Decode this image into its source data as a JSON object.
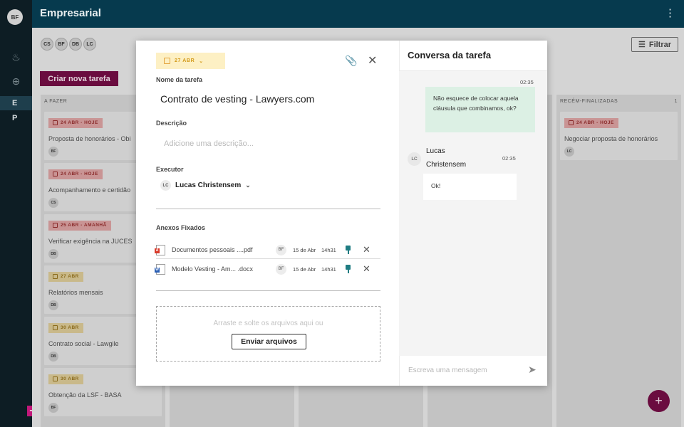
{
  "rail": {
    "avatar": "BF",
    "items": [
      "E",
      "P"
    ]
  },
  "topbar": {
    "title": "Empresarial"
  },
  "users": [
    "CS",
    "BF",
    "DB",
    "LC"
  ],
  "filter_label": "Filtrar",
  "create_task_label": "Criar nova tarefa",
  "columns": [
    {
      "title": "A FAZER",
      "count": "",
      "cards": [
        {
          "due": "24 ABR - HOJE",
          "color": "red",
          "title": "Proposta de honorários - Obi",
          "user": "BF"
        },
        {
          "due": "24 ABR - HOJE",
          "color": "red",
          "title": "Acompanhamento e certidão",
          "user": "CS"
        },
        {
          "due": "25 ABR - AMANHÃ",
          "color": "red",
          "title": "Verificar exigência na JUCES",
          "user": "DB"
        },
        {
          "due": "27 ABR",
          "color": "amber",
          "title": "Relatórios mensais",
          "user": "DB"
        },
        {
          "due": "30 ABR",
          "color": "amber",
          "title": "Contrato social - Lawgile",
          "user": "DB"
        },
        {
          "due": "30 ABR",
          "color": "amber",
          "title": "Obtenção da LSF - BASA",
          "user": "BF"
        }
      ]
    },
    {
      "title": "RECÉM-FINALIZADAS",
      "count": "1",
      "cards": [
        {
          "due": "24 ABR - HOJE",
          "color": "red",
          "title": "Negociar proposta de honorários",
          "user": "LC"
        }
      ]
    }
  ],
  "modal": {
    "due_chip": "27 ABR",
    "task_name_label": "Nome da tarefa",
    "task_name": "Contrato de vesting - Lawyers.com",
    "description_label": "Descrição",
    "description_placeholder": "Adicione uma descrição...",
    "executor_label": "Executor",
    "executor": {
      "initials": "LC",
      "name": "Lucas Christensem"
    },
    "attachments_label": "Anexos Fixados",
    "attachments": [
      {
        "type": "pdf",
        "name": "Documentos pessoais ....pdf",
        "user": "BF",
        "date": "15 de Abr",
        "time": "14h31"
      },
      {
        "type": "docx",
        "name": "Modelo Vesting - Am... .docx",
        "user": "BF",
        "date": "15 de Abr",
        "time": "14h31"
      }
    ],
    "drop_hint": "Arraste e solte os arquivos aqui ou",
    "upload_label": "Enviar arquivos"
  },
  "chat": {
    "title": "Conversa da tarefa",
    "messages": [
      {
        "direction": "out",
        "time": "02:35",
        "text": "Não esquece de colocar aquela cláusula que combinamos, ok?"
      },
      {
        "direction": "in",
        "initials": "LC",
        "sender": "Lucas Christensem",
        "time": "02:35",
        "text": "Ok!"
      }
    ],
    "input_placeholder": "Escreva uma mensagem"
  }
}
